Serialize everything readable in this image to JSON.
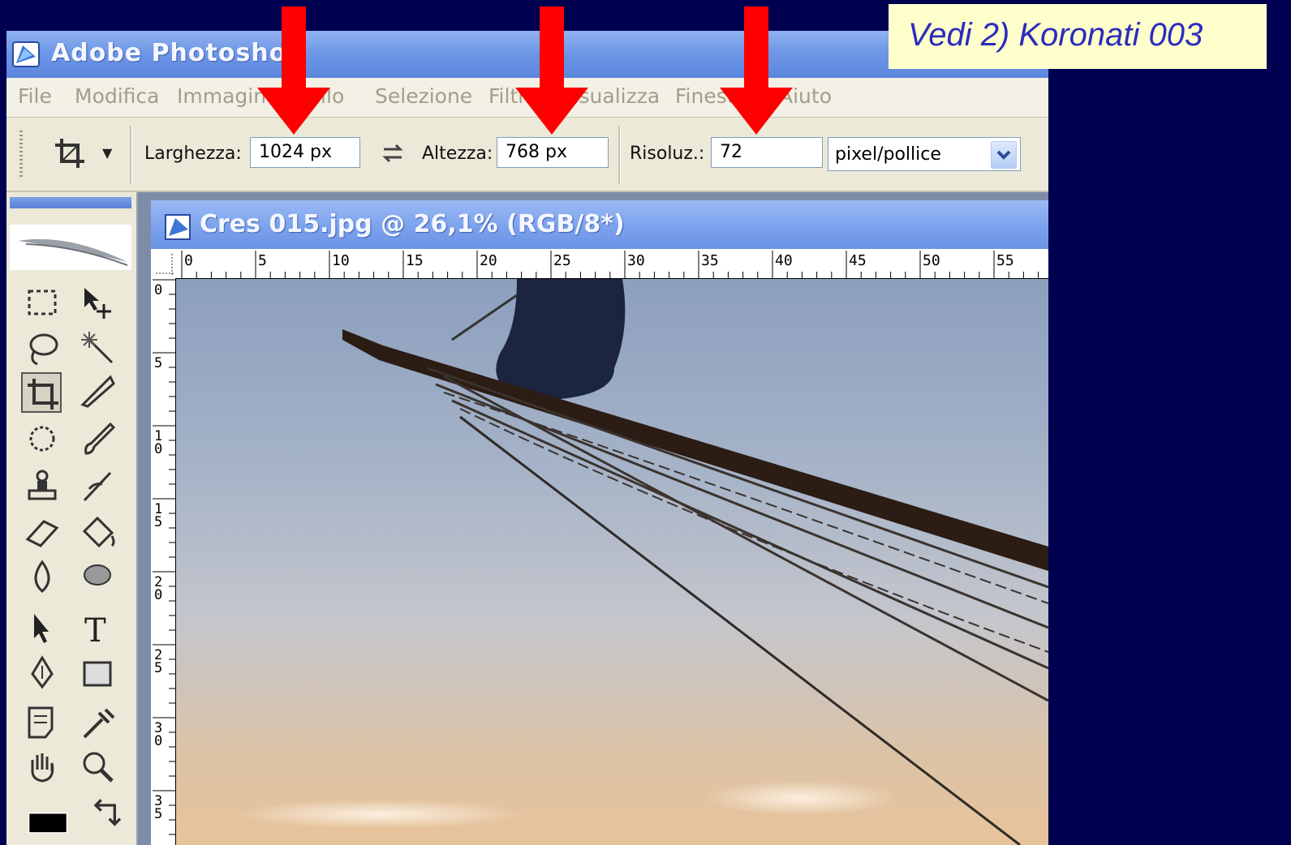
{
  "note": {
    "text": "Vedi 2) Koronati 003"
  },
  "window": {
    "title": "Adobe Photoshop"
  },
  "menu": {
    "items": [
      "File",
      "Modifica",
      "Immagine",
      "Livello",
      "Selezione",
      "Filtro",
      "Visualizza",
      "Finestra",
      "Aiuto"
    ]
  },
  "options": {
    "width_label": "Larghezza:",
    "width_value": "1024 px",
    "height_label": "Altezza:",
    "height_value": "768 px",
    "resolution_label": "Risoluz.:",
    "resolution_value": "72",
    "unit_value": "pixel/pollice"
  },
  "document": {
    "title": "Cres 015.jpg @ 26,1% (RGB/8*)",
    "ruler_top": [
      "0",
      "5",
      "10",
      "15",
      "20",
      "25",
      "30",
      "35",
      "40",
      "45",
      "50",
      "55"
    ],
    "ruler_left": [
      "0",
      "5",
      "10",
      "15",
      "20",
      "25",
      "30",
      "35"
    ]
  },
  "colors": {
    "arrow": "#ff0000",
    "background": "#000050",
    "note_text": "#2b2bbf"
  }
}
